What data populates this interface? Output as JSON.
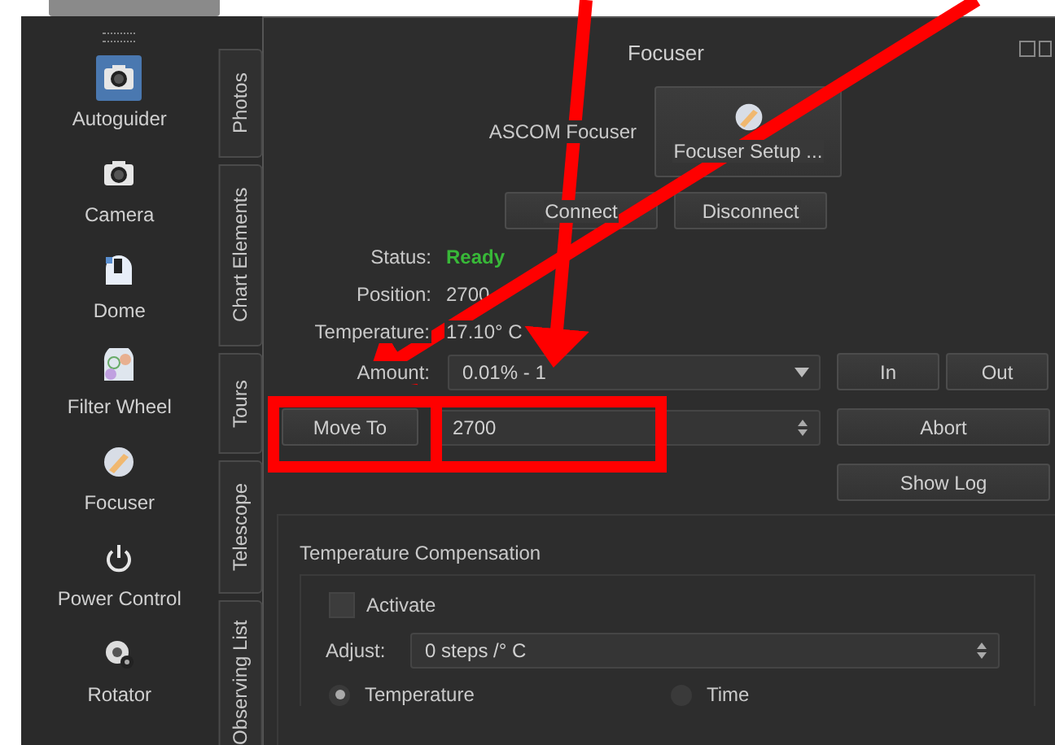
{
  "sidebar": {
    "items": [
      {
        "label": "Autoguider",
        "kind": "autoguider",
        "selected": true
      },
      {
        "label": "Camera",
        "kind": "camera",
        "selected": false
      },
      {
        "label": "Dome",
        "kind": "dome",
        "selected": false
      },
      {
        "label": "Filter Wheel",
        "kind": "filter",
        "selected": false
      },
      {
        "label": "Focuser",
        "kind": "focuser",
        "selected": false
      },
      {
        "label": "Power Control",
        "kind": "power",
        "selected": false
      },
      {
        "label": "Rotator",
        "kind": "rotator",
        "selected": false
      }
    ]
  },
  "side_tabs": [
    "Photos",
    "Chart Elements",
    "Tours",
    "Telescope",
    "Observing List"
  ],
  "panel": {
    "title": "Focuser",
    "device": {
      "label": "ASCOM Focuser",
      "setup_button": "Focuser Setup ..."
    },
    "connect_buttons": [
      "Connect",
      "Disconnect"
    ],
    "status": {
      "label": "Status:",
      "value": "Ready"
    },
    "position": {
      "label": "Position:",
      "value": "2700"
    },
    "temperature": {
      "label": "Temperature:",
      "value": "17.10° C"
    },
    "amount": {
      "label": "Amount:",
      "value": "0.01% - 1"
    },
    "in_out_buttons": [
      "In",
      "Out"
    ],
    "move_to": {
      "button": "Move To",
      "value": "2700"
    },
    "abort_button": "Abort",
    "show_log_button": "Show Log",
    "compensation": {
      "title": "Temperature Compensation",
      "activate": {
        "label": "Activate",
        "checked": false
      },
      "adjust": {
        "label": "Adjust:",
        "value": "0 steps /° C"
      },
      "modes": [
        {
          "label": "Temperature",
          "selected": true
        },
        {
          "label": "Time",
          "selected": false
        }
      ]
    }
  }
}
